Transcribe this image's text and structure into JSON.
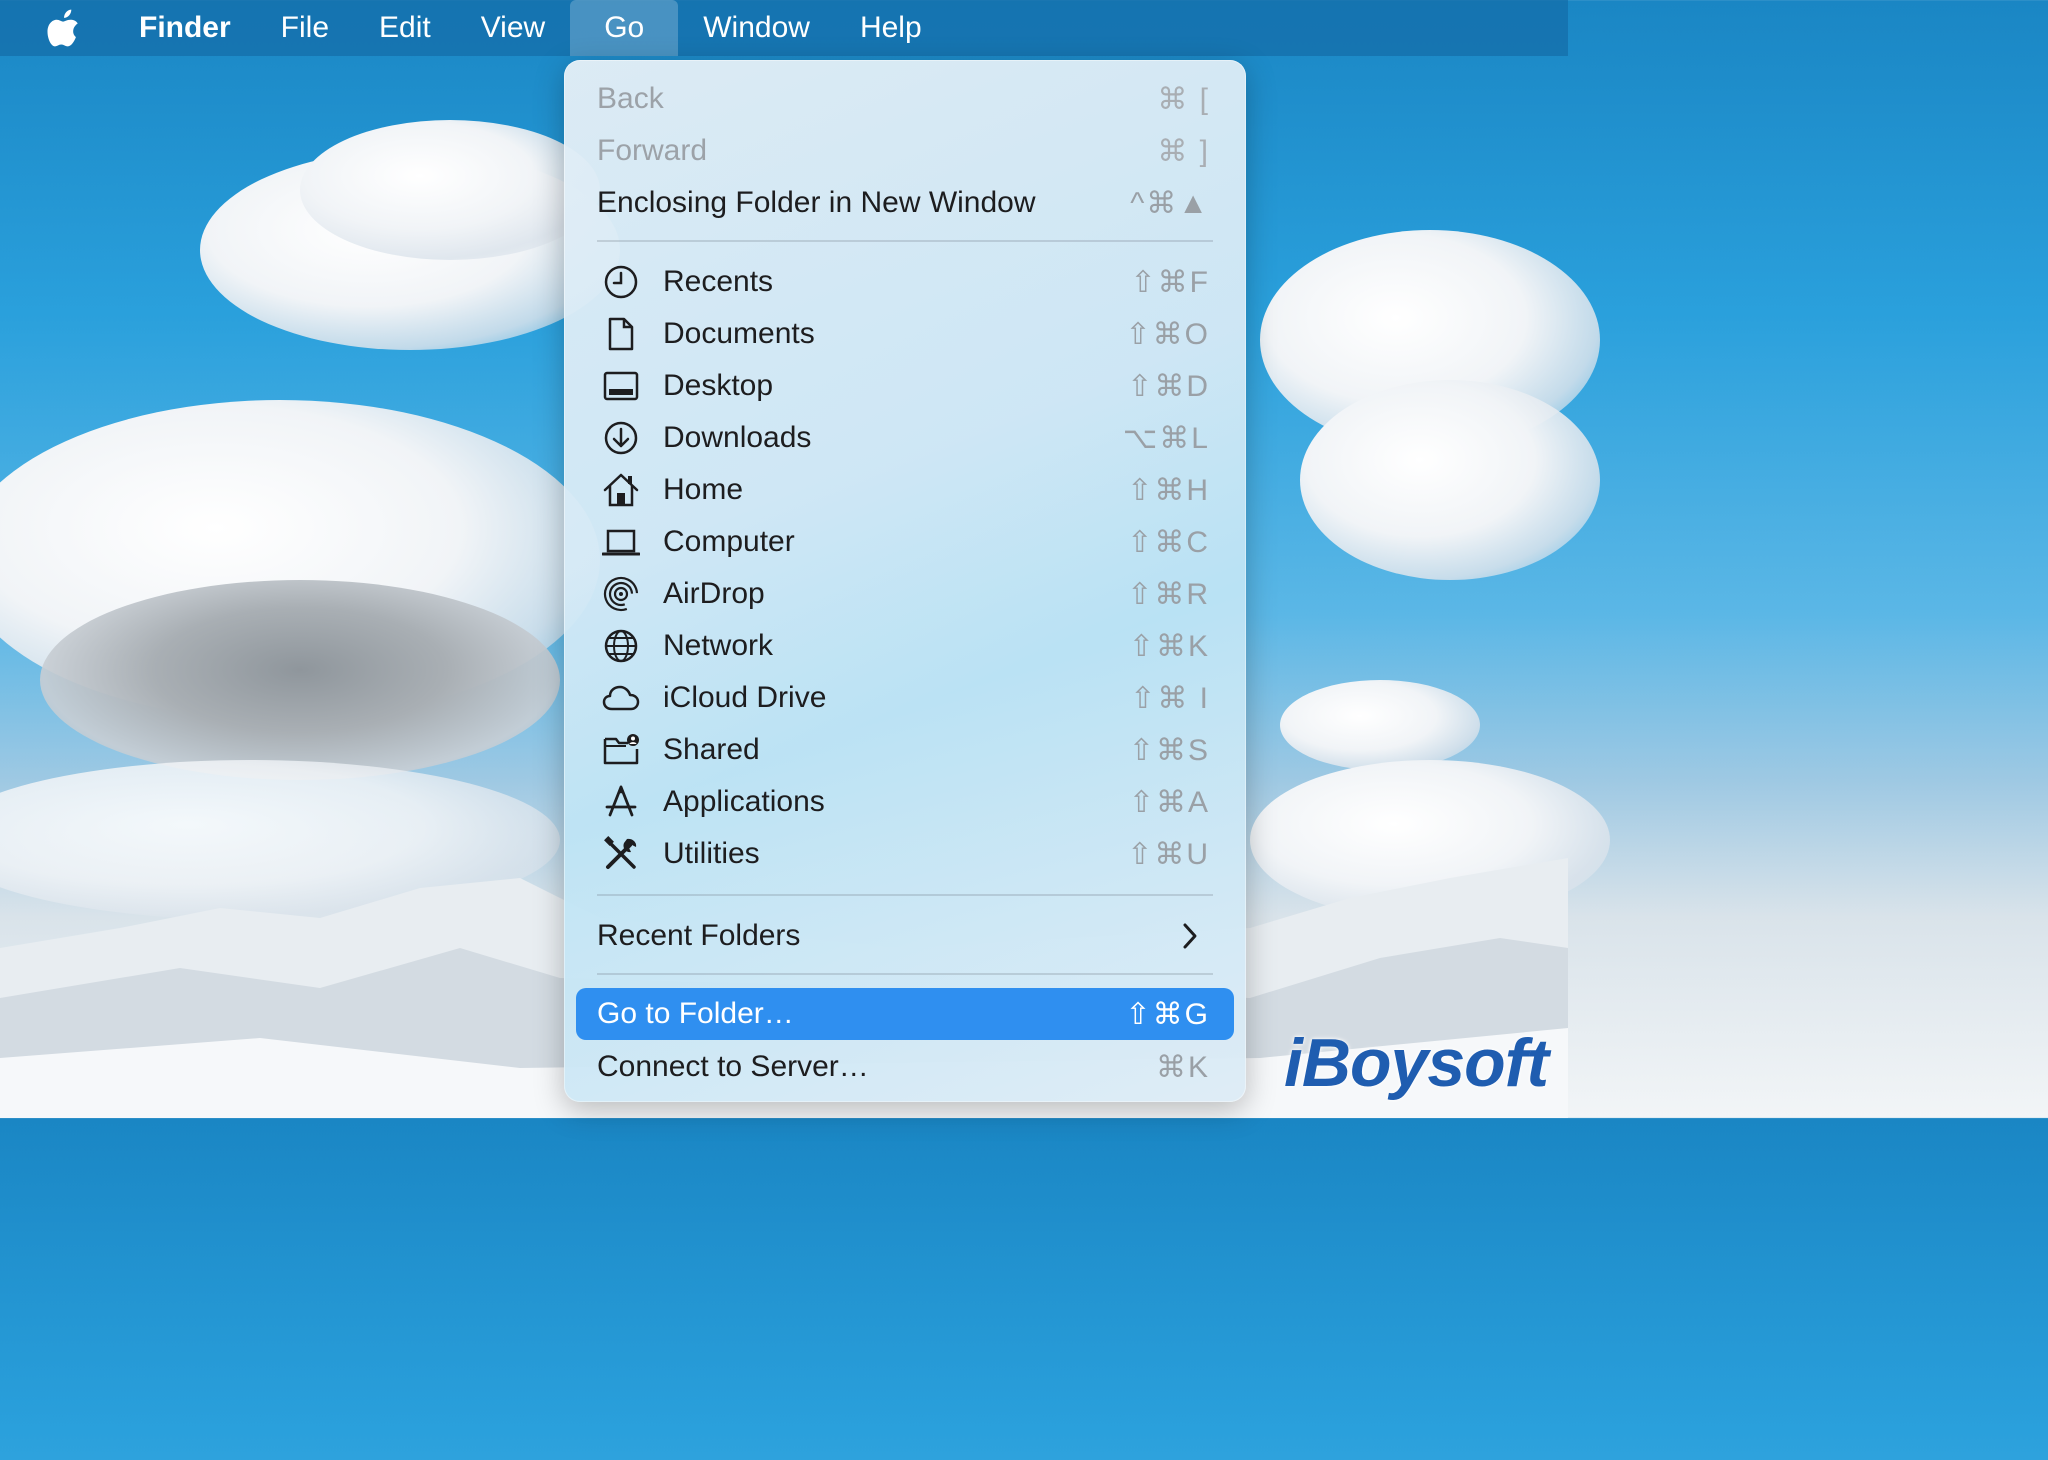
{
  "menubar": {
    "app_name": "Finder",
    "items": [
      "File",
      "Edit",
      "View",
      "Go",
      "Window",
      "Help"
    ],
    "active": "Go"
  },
  "go_menu": {
    "back": {
      "label": "Back",
      "shortcut": "⌘ ["
    },
    "forward": {
      "label": "Forward",
      "shortcut": "⌘ ]"
    },
    "enclosing": {
      "label": "Enclosing Folder in New Window",
      "shortcut": "^⌘▲"
    },
    "locations": [
      {
        "label": "Recents",
        "shortcut": "⇧⌘F",
        "icon": "clock-icon"
      },
      {
        "label": "Documents",
        "shortcut": "⇧⌘O",
        "icon": "document-icon"
      },
      {
        "label": "Desktop",
        "shortcut": "⇧⌘D",
        "icon": "desktop-icon"
      },
      {
        "label": "Downloads",
        "shortcut": "⌥⌘L",
        "icon": "download-icon"
      },
      {
        "label": "Home",
        "shortcut": "⇧⌘H",
        "icon": "home-icon"
      },
      {
        "label": "Computer",
        "shortcut": "⇧⌘C",
        "icon": "laptop-icon"
      },
      {
        "label": "AirDrop",
        "shortcut": "⇧⌘R",
        "icon": "airdrop-icon"
      },
      {
        "label": "Network",
        "shortcut": "⇧⌘K",
        "icon": "globe-icon"
      },
      {
        "label": "iCloud Drive",
        "shortcut": "⇧⌘ I",
        "icon": "cloud-icon"
      },
      {
        "label": "Shared",
        "shortcut": "⇧⌘S",
        "icon": "shared-folder-icon"
      },
      {
        "label": "Applications",
        "shortcut": "⇧⌘A",
        "icon": "applications-icon"
      },
      {
        "label": "Utilities",
        "shortcut": "⇧⌘U",
        "icon": "tools-icon"
      }
    ],
    "recent_folders": {
      "label": "Recent Folders"
    },
    "go_to_folder": {
      "label": "Go to Folder…",
      "shortcut": "⇧⌘G"
    },
    "connect_server": {
      "label": "Connect to Server…",
      "shortcut": "⌘K"
    }
  },
  "watermark": "iBoysoft",
  "colors": {
    "highlight": "#2f8ff0",
    "menubar": "#146eaa"
  }
}
